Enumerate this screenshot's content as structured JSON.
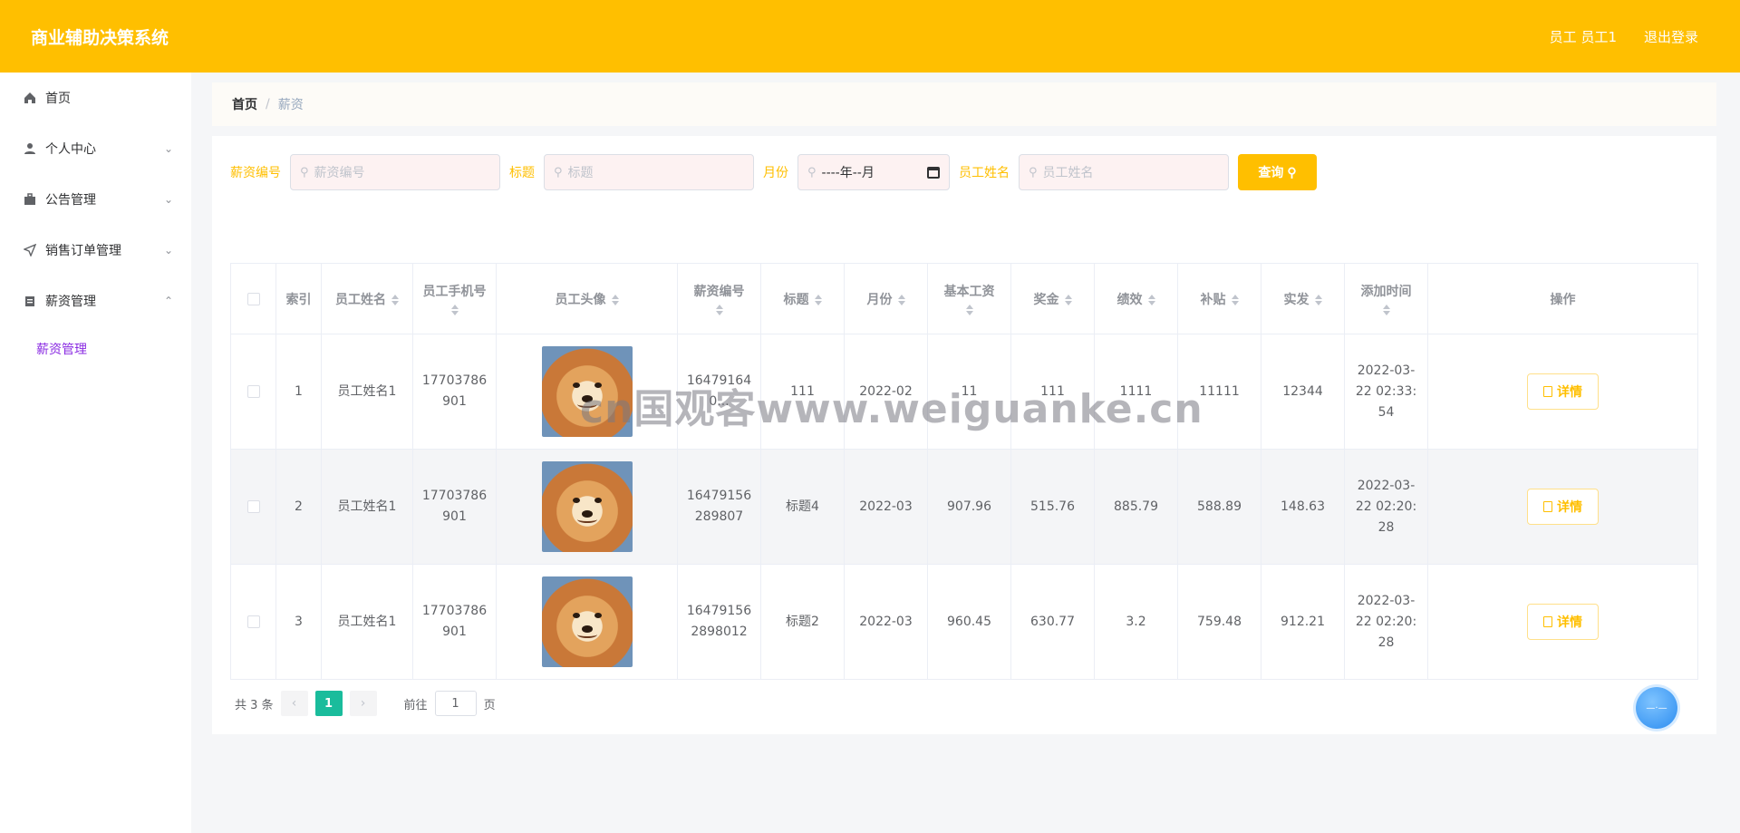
{
  "header": {
    "brand": "商业辅助决策系统",
    "user": "员工 员工1",
    "logout": "退出登录"
  },
  "sidebar": {
    "items": [
      {
        "label": "首页",
        "icon": "home-icon"
      },
      {
        "label": "个人中心",
        "icon": "user-icon"
      },
      {
        "label": "公告管理",
        "icon": "briefcase-icon"
      },
      {
        "label": "销售订单管理",
        "icon": "send-icon"
      },
      {
        "label": "薪资管理",
        "icon": "clipboard-icon"
      }
    ],
    "sub_item": "薪资管理"
  },
  "breadcrumb": {
    "home": "首页",
    "sep": "/",
    "current": "薪资"
  },
  "search": {
    "f1_label": "薪资编号",
    "f1_placeholder": "薪资编号",
    "f2_label": "标题",
    "f2_placeholder": "标题",
    "f3_label": "月份",
    "f3_value": "----年--月",
    "f4_label": "员工姓名",
    "f4_placeholder": "员工姓名",
    "query_label": "查询"
  },
  "table": {
    "headers": [
      "索引",
      "员工姓名",
      "员工手机号",
      "员工头像",
      "薪资编号",
      "标题",
      "月份",
      "基本工资",
      "奖金",
      "绩效",
      "补贴",
      "实发",
      "添加时间",
      "操作"
    ],
    "rows": [
      {
        "idx": "1",
        "name": "员工姓名1",
        "phone": "17703786901",
        "salary_no": "164791640...",
        "title": "111",
        "month": "2022-02",
        "base": "11",
        "bonus": "111",
        "perf": "1111",
        "allowance": "11111",
        "actual": "12344",
        "time": "2022-03-22 02:33:54",
        "action": "详情"
      },
      {
        "idx": "2",
        "name": "员工姓名1",
        "phone": "17703786901",
        "salary_no": "16479156289807",
        "title": "标题4",
        "month": "2022-03",
        "base": "907.96",
        "bonus": "515.76",
        "perf": "885.79",
        "allowance": "588.89",
        "actual": "148.63",
        "time": "2022-03-22 02:20:28",
        "action": "详情"
      },
      {
        "idx": "3",
        "name": "员工姓名1",
        "phone": "17703786901",
        "salary_no": "164791562898012",
        "title": "标题2",
        "month": "2022-03",
        "base": "960.45",
        "bonus": "630.77",
        "perf": "3.2",
        "allowance": "759.48",
        "actual": "912.21",
        "time": "2022-03-22 02:20:28",
        "action": "详情"
      }
    ]
  },
  "pagination": {
    "total": "共 3 条",
    "page": "1",
    "goto": "前往",
    "goto_value": "1",
    "unit": "页"
  },
  "watermark": "cn国观客www.weiguanke.cn"
}
